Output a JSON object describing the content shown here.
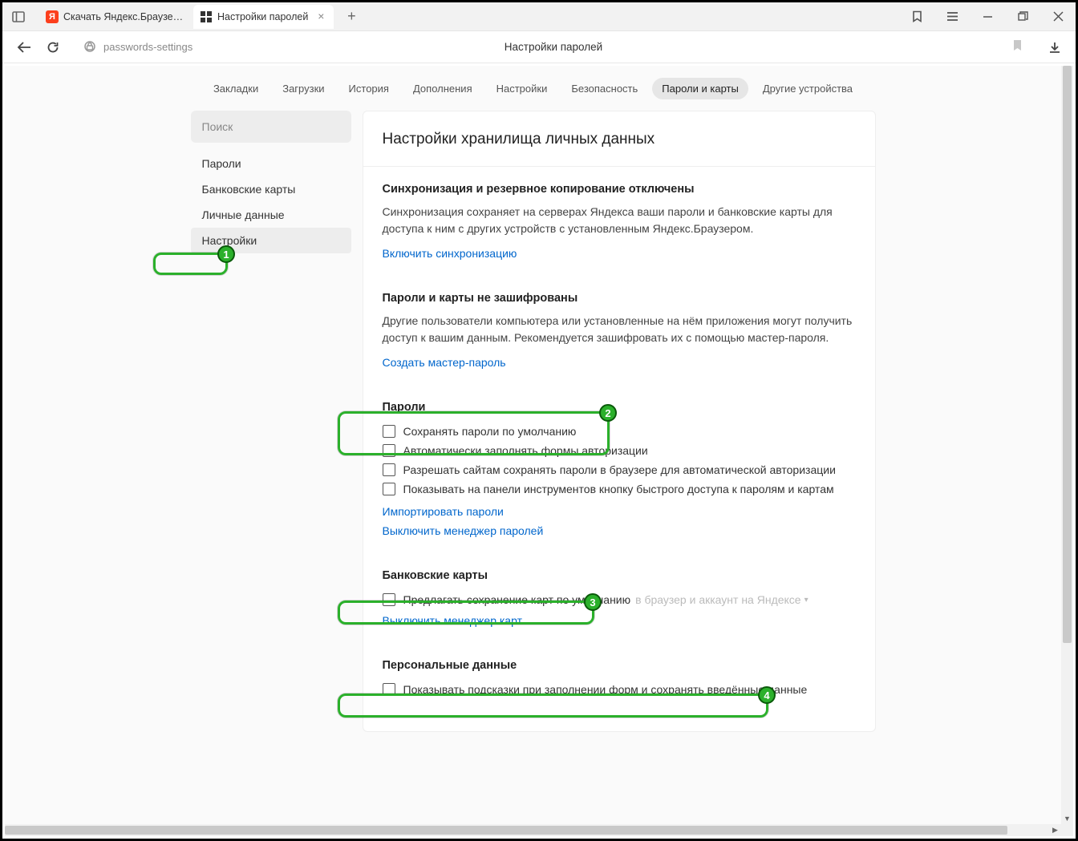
{
  "tabs": {
    "inactive": {
      "label": "Скачать Яндекс.Браузер д"
    },
    "active": {
      "label": "Настройки паролей"
    }
  },
  "address": {
    "url": "passwords-settings",
    "title": "Настройки паролей"
  },
  "page_nav": [
    "Закладки",
    "Загрузки",
    "История",
    "Дополнения",
    "Настройки",
    "Безопасность",
    "Пароли и карты",
    "Другие устройства"
  ],
  "page_nav_active_index": 6,
  "sidebar": {
    "search_placeholder": "Поиск",
    "items": [
      "Пароли",
      "Банковские карты",
      "Личные данные",
      "Настройки"
    ],
    "active_index": 3
  },
  "main": {
    "title": "Настройки хранилища личных данных",
    "sync": {
      "heading": "Синхронизация и резервное копирование отключены",
      "body": "Синхронизация сохраняет на серверах Яндекса ваши пароли и банковские карты для доступа к ним с других устройств с установленным Яндекс.Браузером.",
      "link": "Включить синхронизацию"
    },
    "encrypt": {
      "heading": "Пароли и карты не зашифрованы",
      "body": "Другие пользователи компьютера или установленные на нём приложения могут получить доступ к вашим данным. Рекомендуется зашифровать их с помощью мастер-пароля.",
      "link": "Создать мастер-пароль"
    },
    "passwords": {
      "heading": "Пароли",
      "opts": [
        "Сохранять пароли по умолчанию",
        "Автоматически заполнять формы авторизации",
        "Разрешать сайтам сохранять пароли в браузере для автоматической авторизации",
        "Показывать на панели инструментов кнопку быстрого доступа к паролям и картам"
      ],
      "links": [
        "Импортировать пароли",
        "Выключить менеджер паролей"
      ]
    },
    "cards": {
      "heading": "Банковские карты",
      "opt": "Предлагать сохранение карт по умолчанию",
      "hint_suffix": "в браузер и аккаунт на Яндексе",
      "link": "Выключить менеджер карт"
    },
    "personal": {
      "heading": "Персональные данные",
      "opt": "Показывать подсказки при заполнении форм и сохранять введённые данные"
    }
  },
  "annotations": {
    "1": "1",
    "2": "2",
    "3": "3",
    "4": "4"
  }
}
